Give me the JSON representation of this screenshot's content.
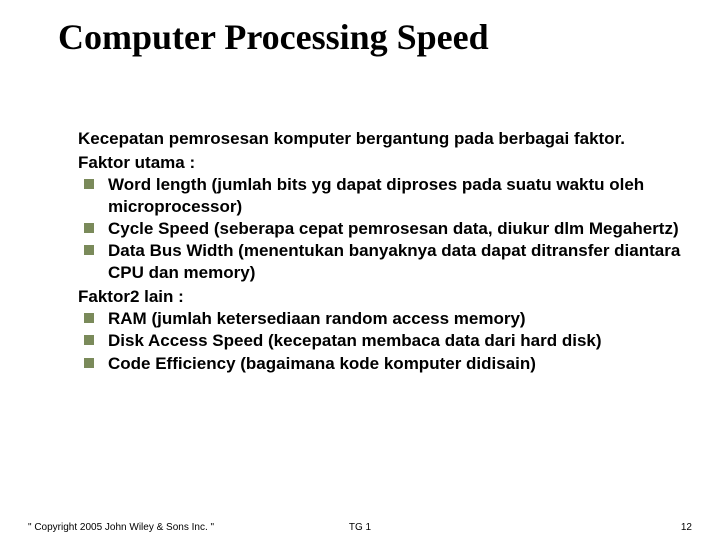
{
  "title": "Computer Processing Speed",
  "intro": "Kecepatan pemrosesan komputer bergantung pada berbagai faktor.",
  "section1_label": "Faktor utama :",
  "section1_items": [
    "Word length (jumlah bits yg dapat diproses pada suatu waktu oleh microprocessor)",
    "Cycle Speed (seberapa cepat pemrosesan data, diukur dlm Megahertz)",
    "Data Bus Width (menentukan  banyaknya data dapat ditransfer diantara CPU dan memory)"
  ],
  "section2_label": "Faktor2 lain :",
  "section2_items": [
    "RAM (jumlah ketersediaan random access memory)",
    "Disk Access Speed (kecepatan membaca data dari hard disk)",
    "Code Efficiency (bagaimana kode komputer didisain)"
  ],
  "footer": {
    "copyright": "\" Copyright 2005 John Wiley & Sons Inc. \"",
    "center": "TG 1",
    "page": "12"
  }
}
